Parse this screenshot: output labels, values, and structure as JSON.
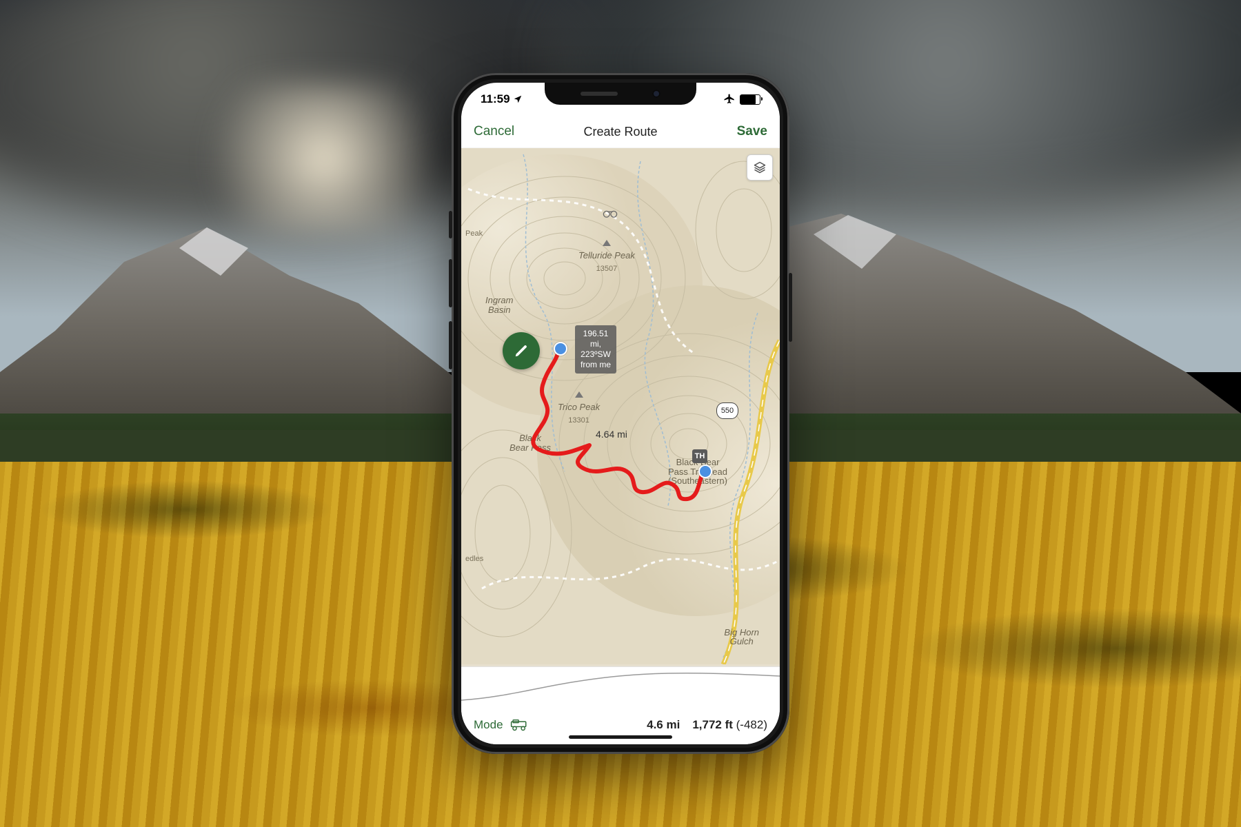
{
  "status_bar": {
    "time": "11:59",
    "airplane_mode": true,
    "battery_pct": 80
  },
  "navbar": {
    "cancel": "Cancel",
    "title": "Create Route",
    "save": "Save"
  },
  "map": {
    "layers_icon": "layers-icon",
    "tooltip": {
      "line1": "196.51",
      "line2": "mi,",
      "line3": "223ºSW",
      "line4": "from me"
    },
    "route_distance_label": "4.64 mi",
    "edit_icon": "pencil-icon",
    "labels": {
      "ingram_basin": "Ingram\nBasin",
      "telluride_peak": "Telluride Peak",
      "telluride_elev": "13507",
      "trico_peak": "Trico Peak",
      "trico_elev": "13301",
      "black_bear_pass": "Black\nBear Pass",
      "trailhead": "Black Bear\nPass Trailhead\n(Southeastern)",
      "big_horn": "Big Horn\nGulch",
      "hwy": "550",
      "peak_generic": "Peak",
      "needles": "edles"
    }
  },
  "toolbar": {
    "mode_label": "Mode",
    "mode_icon": "jeep-icon",
    "distance": "4.6 mi",
    "elevation_gain": "1,772 ft",
    "elevation_loss": "(-482)"
  },
  "colors": {
    "accent": "#2d6a36",
    "route": "#e51b1b"
  }
}
